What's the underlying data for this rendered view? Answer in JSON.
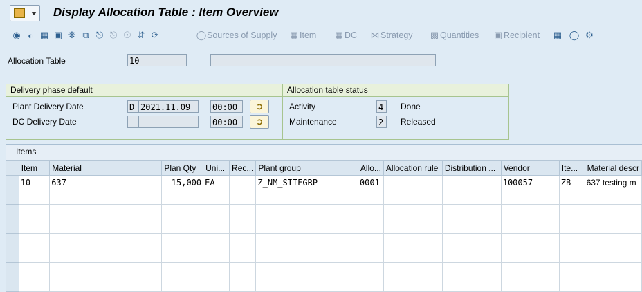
{
  "window": {
    "title": "Display Allocation Table : Item Overview"
  },
  "toolbar": {
    "sources_label": "Sources of Supply",
    "item_label": "Item",
    "dc_label": "DC",
    "strategy_label": "Strategy",
    "quantities_label": "Quantities",
    "recipient_label": "Recipient"
  },
  "header": {
    "allocation_table_label": "Allocation Table",
    "allocation_table_value": "10",
    "description_value": ""
  },
  "delivery_phase": {
    "title": "Delivery phase default",
    "plant_label": "Plant Delivery Date",
    "plant_type": "D",
    "plant_date": "2021.11.09",
    "plant_time": "00:00",
    "dc_label": "DC Delivery Date",
    "dc_type": "",
    "dc_date": "",
    "dc_time": "00:00"
  },
  "status": {
    "title": "Allocation table status",
    "activity_label": "Activity",
    "activity_code": "4",
    "activity_text": "Done",
    "maintenance_label": "Maintenance",
    "maintenance_code": "2",
    "maintenance_text": "Released"
  },
  "items": {
    "title": "Items",
    "columns": [
      "Item",
      "Material",
      "Plan Qty",
      "Uni...",
      "Rec...",
      "Plant group",
      "Allo...",
      "Allocation rule",
      "Distribution ...",
      "Vendor",
      "Ite...",
      "Material descr"
    ],
    "rows": [
      [
        "10",
        "637",
        "15,000",
        "EA",
        "",
        "Z_NM_SITEGRP",
        "0001",
        "",
        "",
        "100057",
        "ZB",
        "637 testing m"
      ]
    ]
  }
}
